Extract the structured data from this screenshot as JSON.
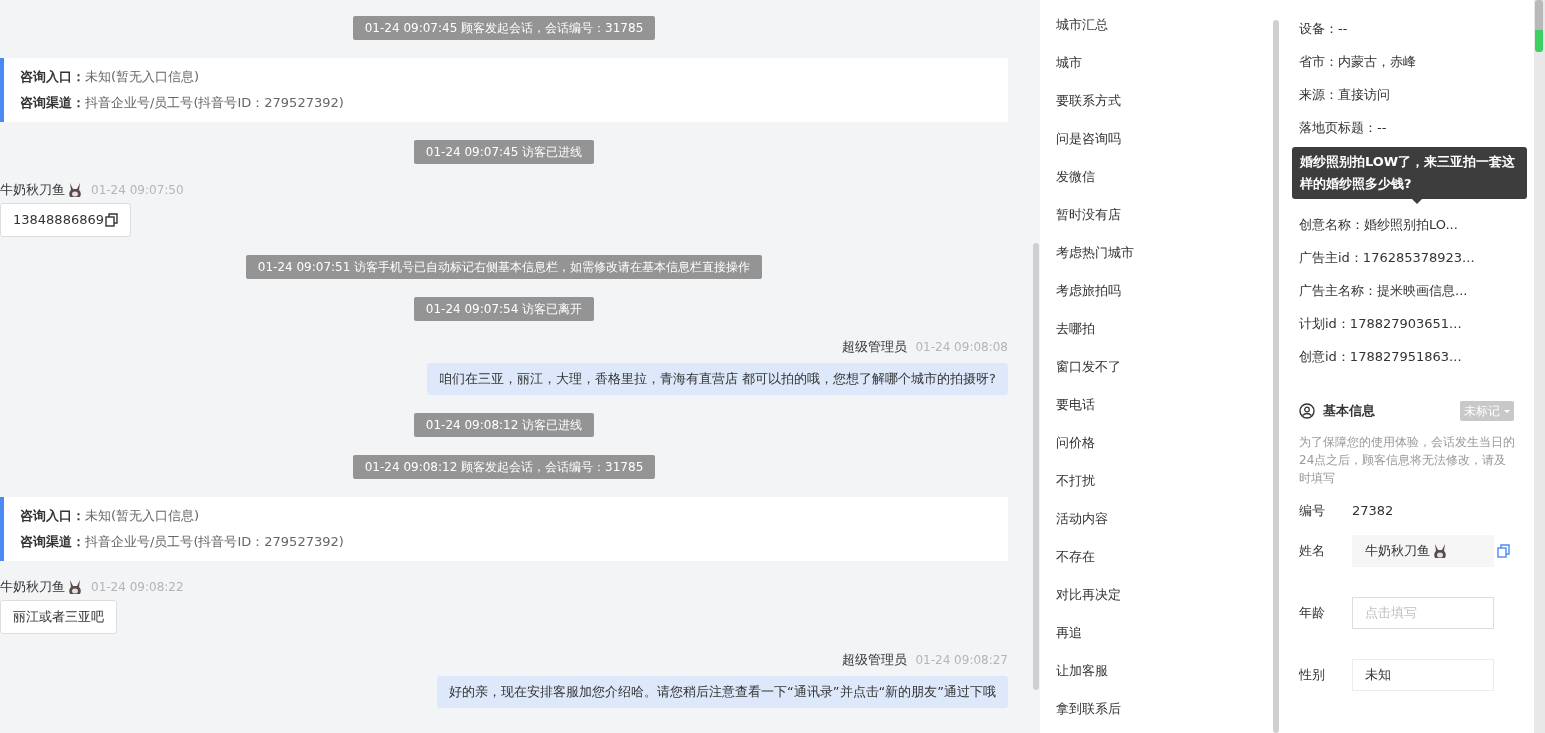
{
  "chat": {
    "messages": [
      {
        "kind": "system",
        "text": "01-24 09:07:45 顾客发起会话，会话编号：31785"
      },
      {
        "kind": "entry",
        "lines": [
          {
            "label": "咨询入口：",
            "value": "未知(暂无入口信息)"
          },
          {
            "label": "咨询渠道：",
            "value": "抖音企业号/员工号(抖音号ID：279527392)"
          }
        ]
      },
      {
        "kind": "system",
        "text": "01-24 09:07:45 访客已进线"
      },
      {
        "kind": "visitor",
        "name": "牛奶秋刀鱼",
        "time": "01-24 09:07:50",
        "text": "13848886869",
        "copyable": true
      },
      {
        "kind": "system",
        "text": "01-24 09:07:51 访客手机号已自动标记右侧基本信息栏，如需修改请在基本信息栏直接操作"
      },
      {
        "kind": "system",
        "text": "01-24 09:07:54 访客已离开"
      },
      {
        "kind": "agent",
        "name": "超级管理员",
        "time": "01-24 09:08:08",
        "text": "咱们在三亚，丽江，大理，香格里拉，青海有直营店 都可以拍的哦，您想了解哪个城市的拍摄呀?"
      },
      {
        "kind": "system",
        "text": "01-24 09:08:12 访客已进线"
      },
      {
        "kind": "system",
        "text": "01-24 09:08:12 顾客发起会话，会话编号：31785"
      },
      {
        "kind": "entry",
        "lines": [
          {
            "label": "咨询入口：",
            "value": "未知(暂无入口信息)"
          },
          {
            "label": "咨询渠道：",
            "value": "抖音企业号/员工号(抖音号ID：279527392)"
          }
        ]
      },
      {
        "kind": "visitor",
        "name": "牛奶秋刀鱼",
        "time": "01-24 09:08:22",
        "text": "丽江或者三亚吧",
        "copyable": false
      },
      {
        "kind": "agent",
        "name": "超级管理员",
        "time": "01-24 09:08:27",
        "text": "好的亲，现在安排客服加您介绍哈。请您稍后注意查看一下“通讯录”并点击“新的朋友”通过下哦"
      }
    ]
  },
  "quick_replies": [
    "城市汇总",
    "城市",
    "要联系方式",
    "问是咨询吗",
    "发微信",
    "暂时没有店",
    "考虑热门城市",
    "考虑旅拍吗",
    "去哪拍",
    "窗口发不了",
    "要电话",
    "问价格",
    "不打扰",
    "活动内容",
    "不存在",
    "对比再决定",
    "再追",
    "让加客服",
    "拿到联系后"
  ],
  "info_panel": {
    "details": [
      {
        "kind": "row",
        "text": "设备：--"
      },
      {
        "kind": "row",
        "text": "省市：内蒙古，赤峰"
      },
      {
        "kind": "row",
        "text": "来源：直接访问"
      },
      {
        "kind": "row",
        "text": "落地页标题：--"
      },
      {
        "kind": "tooltip",
        "text": "婚纱照别拍LOW了，来三亚拍一套这样的婚纱照多少钱?"
      },
      {
        "kind": "row",
        "text": "创意名称：婚纱照别拍LO..."
      },
      {
        "kind": "row",
        "text": "广告主id：176285378923..."
      },
      {
        "kind": "row",
        "text": "广告主名称：提米映画信息..."
      },
      {
        "kind": "row",
        "text": "计划id：178827903651..."
      },
      {
        "kind": "row",
        "text": "创意id：178827951863..."
      }
    ],
    "basic_info": {
      "title": "基本信息",
      "tag": "未标记",
      "notice": "为了保障您的使用体验，会话发生当日的24点之后，顾客信息将无法修改，请及时填写",
      "fields": [
        {
          "kind": "text",
          "label": "编号",
          "value": "27382"
        },
        {
          "kind": "readonly",
          "label": "姓名",
          "value": "牛奶秋刀鱼",
          "copyable": true
        },
        {
          "kind": "input",
          "label": "年龄",
          "placeholder": "点击填写"
        },
        {
          "kind": "select",
          "label": "性别",
          "value": "未知"
        }
      ]
    }
  }
}
